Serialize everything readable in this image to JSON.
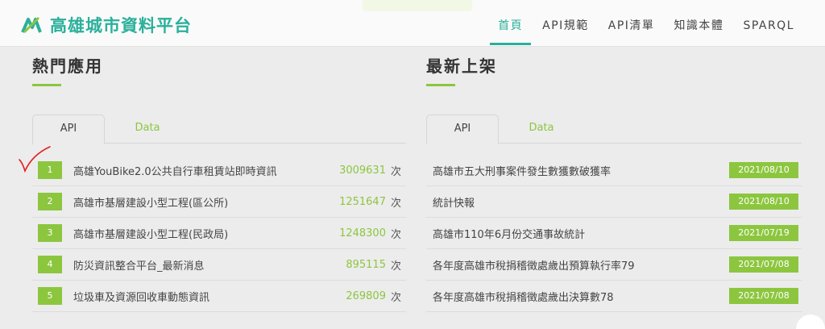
{
  "header": {
    "logo_text": "高雄城市資料平台",
    "nav": [
      "首頁",
      "API規範",
      "API清單",
      "知識本體",
      "SPARQL"
    ]
  },
  "popular": {
    "title": "熱門應用",
    "tabs": [
      "API",
      "Data"
    ],
    "unit": "次",
    "items": [
      {
        "rank": "1",
        "title": "高雄YouBike2.0公共自行車租賃站即時資訊",
        "count": "3009631"
      },
      {
        "rank": "2",
        "title": "高雄市基層建設小型工程(區公所)",
        "count": "1251647"
      },
      {
        "rank": "3",
        "title": "高雄市基層建設小型工程(民政局)",
        "count": "1248300"
      },
      {
        "rank": "4",
        "title": "防災資訊整合平台_最新消息",
        "count": "895115"
      },
      {
        "rank": "5",
        "title": "垃圾車及資源回收車動態資訊",
        "count": "269809"
      }
    ]
  },
  "latest": {
    "title": "最新上架",
    "tabs": [
      "API",
      "Data"
    ],
    "items": [
      {
        "title": "高雄市五大刑事案件發生數獲數破獲率",
        "date": "2021/08/10"
      },
      {
        "title": "統計快報",
        "date": "2021/08/10"
      },
      {
        "title": "高雄市110年6月份交通事故統計",
        "date": "2021/07/19"
      },
      {
        "title": "各年度高雄市稅捐稽徵處歲出預算執行率79",
        "date": "2021/07/08"
      },
      {
        "title": "各年度高雄市稅捐稽徵處歲出決算數78",
        "date": "2021/07/08"
      }
    ]
  },
  "colors": {
    "brand": "#2ab09b",
    "accent": "#8cc63f",
    "annotation": "#e02020"
  }
}
